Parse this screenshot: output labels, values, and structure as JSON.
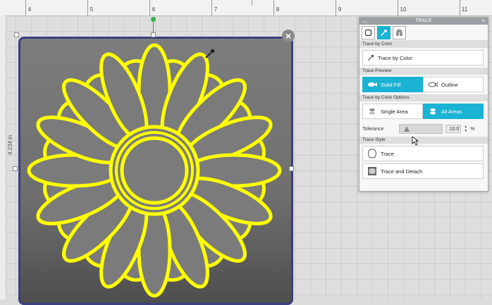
{
  "ruler": {
    "labels": [
      "4",
      "5",
      "6",
      "7",
      "8",
      "9",
      "10",
      "11"
    ]
  },
  "canvas": {
    "dimension_label": "4.234 in"
  },
  "panel": {
    "title": "TRACE",
    "sections": {
      "trace_by_color": {
        "header": "Trace by Color",
        "button_label": "Trace by Color"
      },
      "trace_preview": {
        "header": "Trace Preview",
        "solid_fill": "Solid Fill",
        "outline": "Outline"
      },
      "trace_options": {
        "header": "Trace by Color Options",
        "single_area": "Single Area",
        "all_areas": "All Areas"
      },
      "tolerance": {
        "label": "Tolerance",
        "value": "10.0",
        "unit": "%",
        "level": 0.1
      },
      "trace_style": {
        "header": "Trace Style",
        "trace": "Trace",
        "trace_detach": "Trace and Detach"
      }
    }
  },
  "colors": {
    "accent": "#1ab3d3",
    "outline": "#ffff00",
    "petal_fill": "#7b7b7b",
    "frame": "#3a3f80"
  },
  "icons": [
    "close-icon",
    "rotate-handle-icon",
    "eyedropper-icon",
    "square-trace-icon",
    "magnet-icon",
    "fish-icon",
    "fish-outline-icon",
    "single-area-icon",
    "all-areas-icon",
    "trace-icon",
    "trace-detach-icon"
  ]
}
